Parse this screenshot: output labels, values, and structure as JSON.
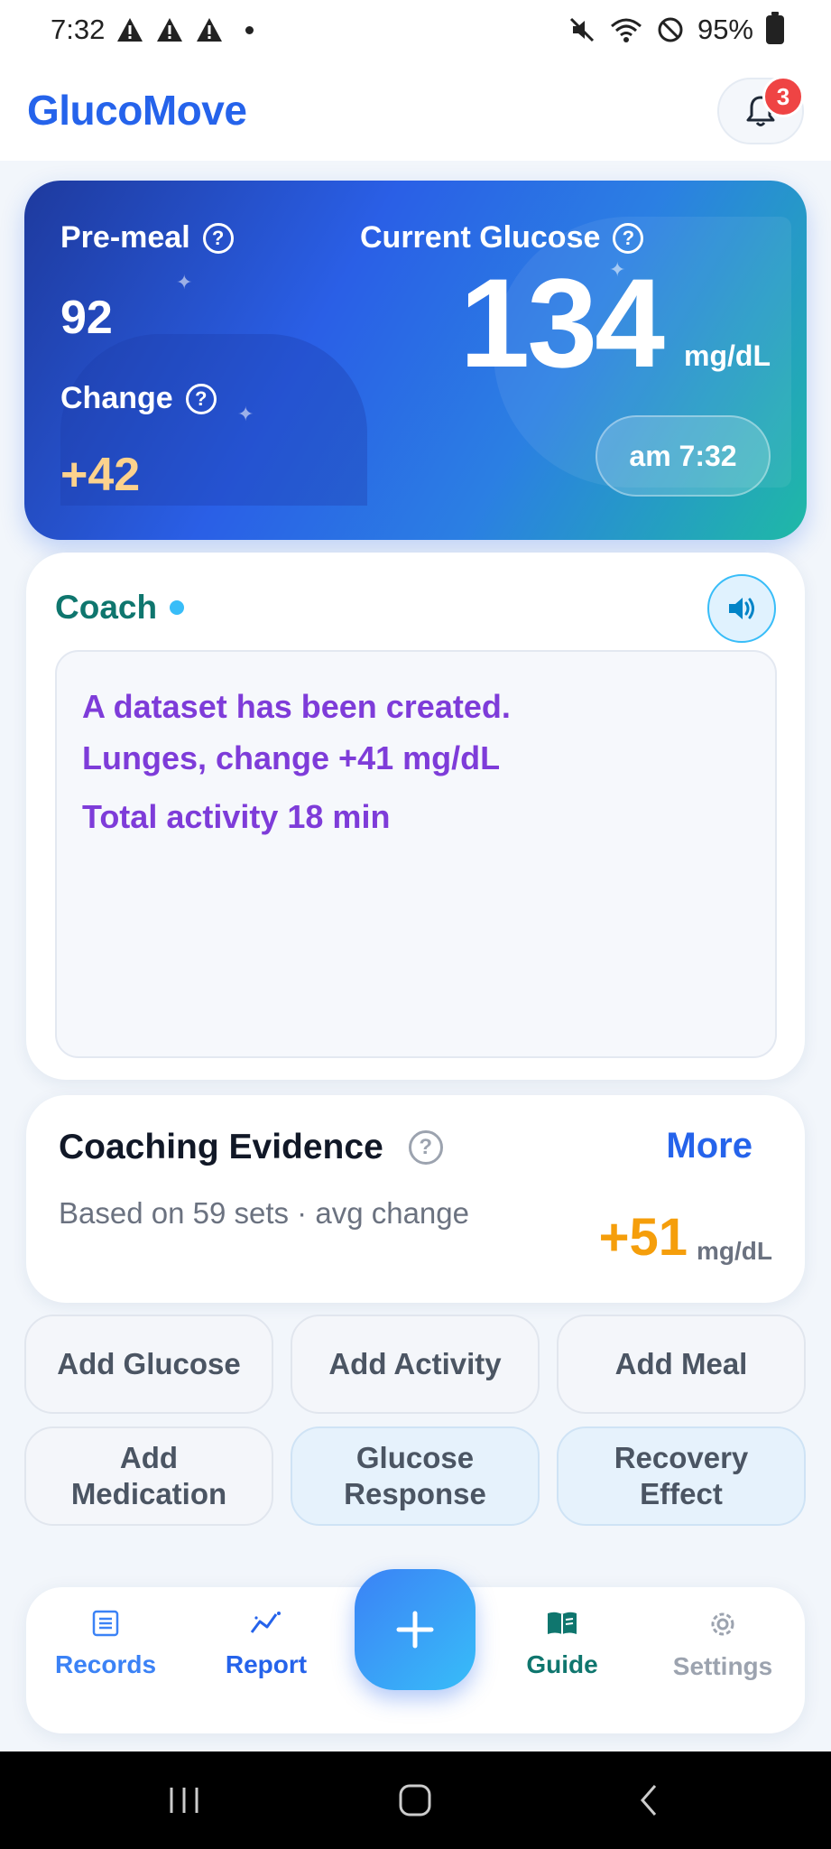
{
  "status_bar": {
    "time": "7:32",
    "battery": "95%"
  },
  "header": {
    "brand": "GlucoMove",
    "notification_count": "3"
  },
  "glucose_card": {
    "pre_meal_label": "Pre-meal",
    "pre_meal_value": "92",
    "change_label": "Change",
    "change_value": "+42",
    "current_label": "Current Glucose",
    "current_value": "134",
    "unit": "mg/dL",
    "time": "am 7:32"
  },
  "coach": {
    "title": "Coach",
    "lines": [
      "A dataset has been created.",
      "Lunges, change +41 mg/dL",
      "Total activity 18 min"
    ]
  },
  "evidence": {
    "title": "Coaching Evidence",
    "more": "More",
    "subtitle": "Based on 59 sets · avg change",
    "value": "+51",
    "unit": "mg/dL"
  },
  "actions": [
    {
      "label": "Add Glucose"
    },
    {
      "label": "Add Activity"
    },
    {
      "label": "Add Meal"
    },
    {
      "label": "Add Medication"
    },
    {
      "label": "Glucose Response"
    },
    {
      "label": "Recovery Effect"
    }
  ],
  "nav": {
    "records": "Records",
    "report": "Report",
    "guide": "Guide",
    "settings": "Settings"
  },
  "colors": {
    "brand": "#2563eb",
    "coach_text": "#7e3cd9",
    "coach_title": "#0f766e",
    "evidence_value": "#f59e0b",
    "badge": "#ef4444"
  }
}
